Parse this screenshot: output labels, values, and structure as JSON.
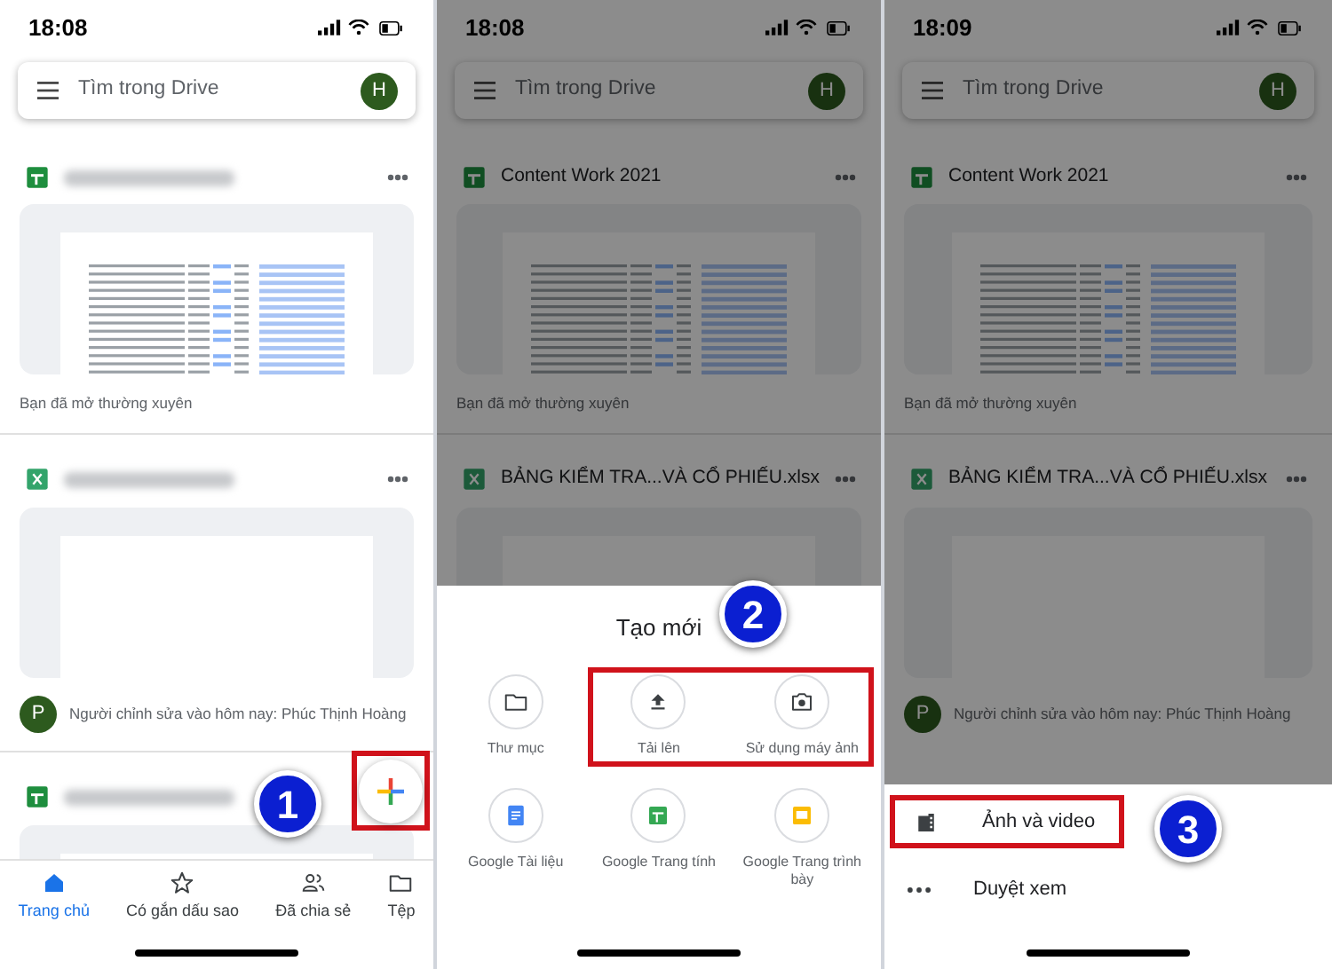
{
  "panels": [
    {
      "time": "18:08",
      "search": {
        "placeholder": "Tìm trong Drive",
        "avatar": "H"
      },
      "dimmed": false,
      "files": [
        {
          "kind": "sheet",
          "blurred": true,
          "caption": "Bạn đã mở thường xuyên"
        },
        {
          "kind": "excel",
          "blurred": true,
          "editor": {
            "avatar": "P",
            "text": "Người chỉnh sửa vào hôm nay: Phúc Thịnh Hoàng"
          }
        },
        {
          "kind": "sheet",
          "blurred": true
        }
      ],
      "fab": {
        "highlighted": true
      },
      "nav": [
        {
          "label": "Trang chủ",
          "kind": "home",
          "selected": true
        },
        {
          "label": "Có gắn dấu sao",
          "kind": "star",
          "selected": false
        },
        {
          "label": "Đã chia sẻ",
          "kind": "people",
          "selected": false
        },
        {
          "label": "Tệp",
          "kind": "folder",
          "selected": false
        }
      ],
      "step": "1"
    },
    {
      "time": "18:08",
      "search": {
        "placeholder": "Tìm trong Drive",
        "avatar": "H"
      },
      "dimmed": true,
      "files": [
        {
          "kind": "sheet",
          "blurred": false,
          "name": "Content Work 2021",
          "caption": "Bạn đã mở thường xuyên"
        },
        {
          "kind": "excel",
          "blurred": false,
          "name": "BẢNG KIỂM TRA...VÀ CỔ PHIẾU.xlsx"
        }
      ],
      "sheet": {
        "kind": "grid",
        "title": "Tạo mới",
        "options": [
          {
            "label": "Thư mục",
            "kind": "folder",
            "highlighted": false
          },
          {
            "label": "Tải lên",
            "kind": "upload",
            "highlighted": true
          },
          {
            "label": "Sử dụng máy ảnh",
            "kind": "camera",
            "highlighted": true
          },
          {
            "label": "Google Tài liệu",
            "kind": "docs",
            "highlighted": false
          },
          {
            "label": "Google Trang tính",
            "kind": "sheets",
            "highlighted": false
          },
          {
            "label": "Google Trang trình bày",
            "kind": "slides",
            "highlighted": false
          }
        ]
      },
      "step": "2"
    },
    {
      "time": "18:09",
      "search": {
        "placeholder": "Tìm trong Drive",
        "avatar": "H"
      },
      "dimmed": true,
      "files": [
        {
          "kind": "sheet",
          "blurred": false,
          "name": "Content Work 2021",
          "caption": "Bạn đã mở thường xuyên"
        },
        {
          "kind": "excel",
          "blurred": false,
          "name": "BẢNG KIỂM TRA...VÀ CỔ PHIẾU.xlsx",
          "editor": {
            "avatar": "P",
            "text": "Người chỉnh sửa vào hôm nay: Phúc Thịnh Hoàng"
          }
        }
      ],
      "sheet": {
        "kind": "list",
        "options": [
          {
            "label": "Ảnh và video",
            "kind": "film",
            "highlighted": true
          },
          {
            "label": "Duyệt xem",
            "kind": "dots",
            "highlighted": false
          }
        ]
      },
      "step": "3"
    }
  ]
}
